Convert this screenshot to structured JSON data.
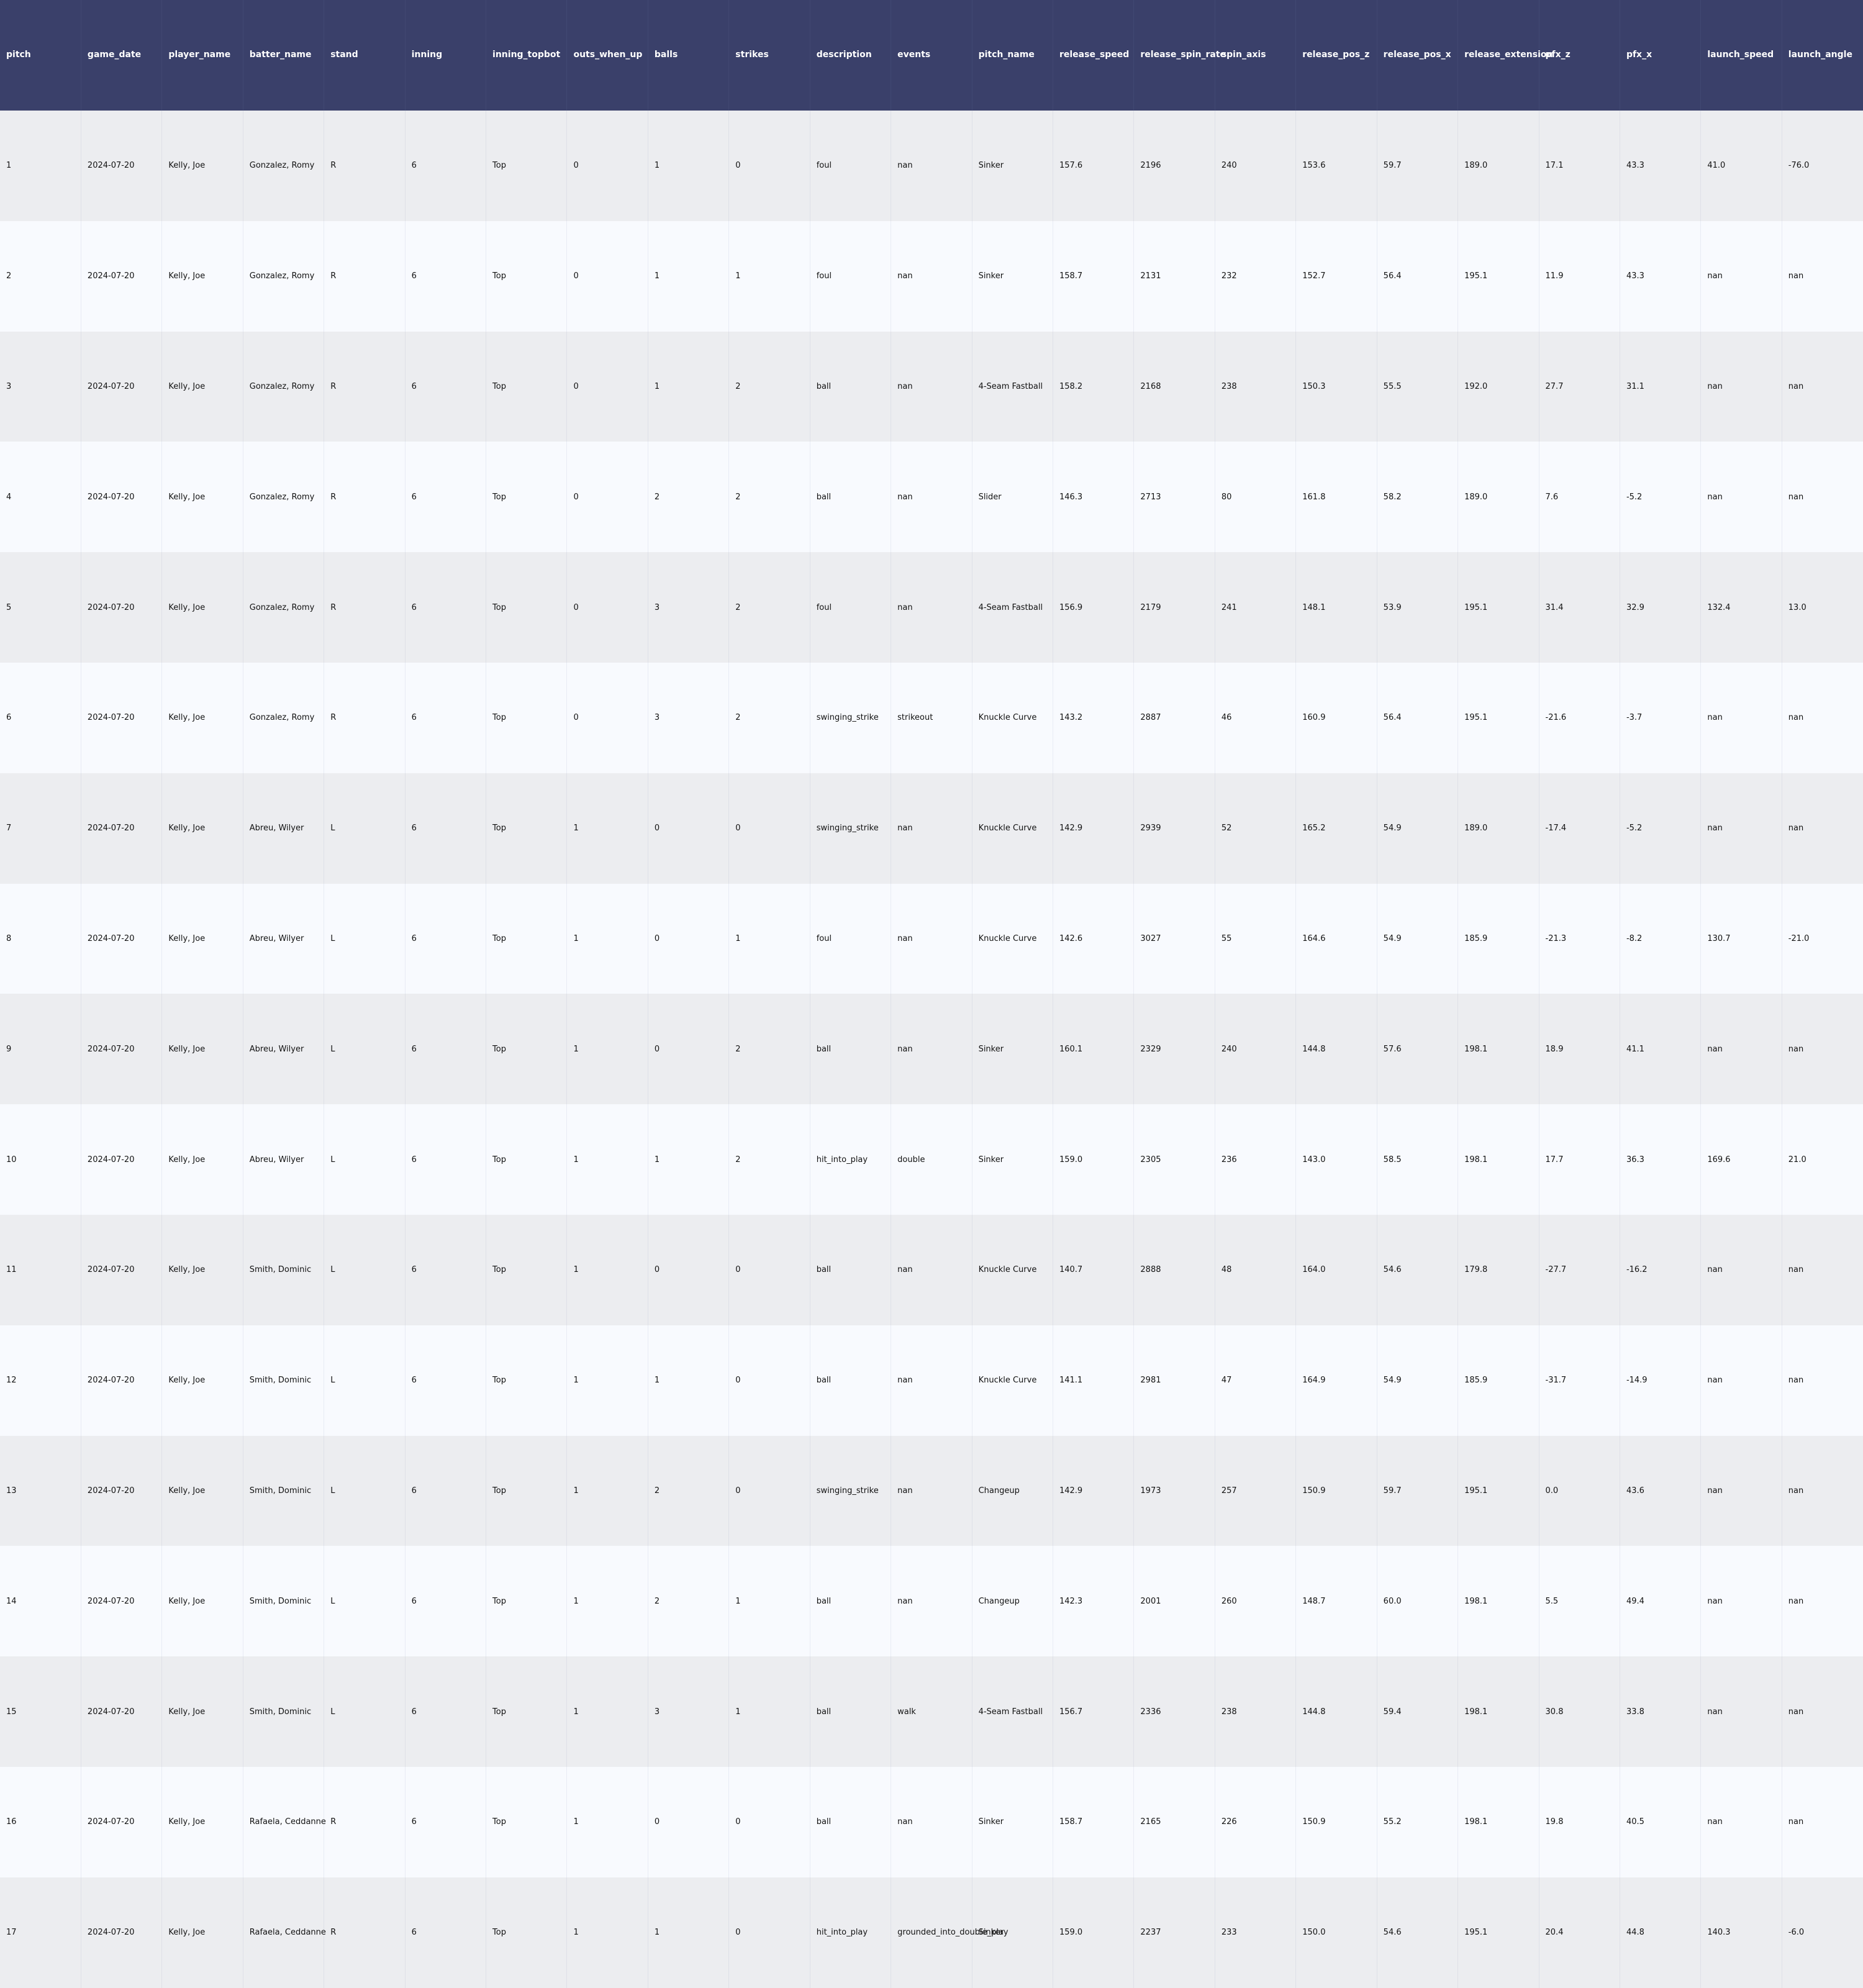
{
  "columns": [
    "pitch",
    "game_date",
    "player_name",
    "batter_name",
    "stand",
    "inning",
    "inning_topbot",
    "outs_when_up",
    "balls",
    "strikes",
    "description",
    "events",
    "pitch_name",
    "release_speed",
    "release_spin_rate",
    "spin_axis",
    "release_pos_z",
    "release_pos_x",
    "release_extension",
    "pfx_z",
    "pfx_x",
    "launch_speed",
    "launch_angle"
  ],
  "rows": [
    [
      "1",
      "2024-07-20",
      "Kelly, Joe",
      "Gonzalez, Romy",
      "R",
      "6",
      "Top",
      "0",
      "1",
      "0",
      "foul",
      "nan",
      "Sinker",
      "157.6",
      "2196",
      "240",
      "153.6",
      "59.7",
      "189.0",
      "17.1",
      "43.3",
      "41.0",
      "-76.0"
    ],
    [
      "2",
      "2024-07-20",
      "Kelly, Joe",
      "Gonzalez, Romy",
      "R",
      "6",
      "Top",
      "0",
      "1",
      "1",
      "foul",
      "nan",
      "Sinker",
      "158.7",
      "2131",
      "232",
      "152.7",
      "56.4",
      "195.1",
      "11.9",
      "43.3",
      "nan",
      "nan"
    ],
    [
      "3",
      "2024-07-20",
      "Kelly, Joe",
      "Gonzalez, Romy",
      "R",
      "6",
      "Top",
      "0",
      "1",
      "2",
      "ball",
      "nan",
      "4-Seam Fastball",
      "158.2",
      "2168",
      "238",
      "150.3",
      "55.5",
      "192.0",
      "27.7",
      "31.1",
      "nan",
      "nan"
    ],
    [
      "4",
      "2024-07-20",
      "Kelly, Joe",
      "Gonzalez, Romy",
      "R",
      "6",
      "Top",
      "0",
      "2",
      "2",
      "ball",
      "nan",
      "Slider",
      "146.3",
      "2713",
      "80",
      "161.8",
      "58.2",
      "189.0",
      "7.6",
      "-5.2",
      "nan",
      "nan"
    ],
    [
      "5",
      "2024-07-20",
      "Kelly, Joe",
      "Gonzalez, Romy",
      "R",
      "6",
      "Top",
      "0",
      "3",
      "2",
      "foul",
      "nan",
      "4-Seam Fastball",
      "156.9",
      "2179",
      "241",
      "148.1",
      "53.9",
      "195.1",
      "31.4",
      "32.9",
      "132.4",
      "13.0"
    ],
    [
      "6",
      "2024-07-20",
      "Kelly, Joe",
      "Gonzalez, Romy",
      "R",
      "6",
      "Top",
      "0",
      "3",
      "2",
      "swinging_strike",
      "strikeout",
      "Knuckle Curve",
      "143.2",
      "2887",
      "46",
      "160.9",
      "56.4",
      "195.1",
      "-21.6",
      "-3.7",
      "nan",
      "nan"
    ],
    [
      "7",
      "2024-07-20",
      "Kelly, Joe",
      "Abreu, Wilyer",
      "L",
      "6",
      "Top",
      "1",
      "0",
      "0",
      "swinging_strike",
      "nan",
      "Knuckle Curve",
      "142.9",
      "2939",
      "52",
      "165.2",
      "54.9",
      "189.0",
      "-17.4",
      "-5.2",
      "nan",
      "nan"
    ],
    [
      "8",
      "2024-07-20",
      "Kelly, Joe",
      "Abreu, Wilyer",
      "L",
      "6",
      "Top",
      "1",
      "0",
      "1",
      "foul",
      "nan",
      "Knuckle Curve",
      "142.6",
      "3027",
      "55",
      "164.6",
      "54.9",
      "185.9",
      "-21.3",
      "-8.2",
      "130.7",
      "-21.0"
    ],
    [
      "9",
      "2024-07-20",
      "Kelly, Joe",
      "Abreu, Wilyer",
      "L",
      "6",
      "Top",
      "1",
      "0",
      "2",
      "ball",
      "nan",
      "Sinker",
      "160.1",
      "2329",
      "240",
      "144.8",
      "57.6",
      "198.1",
      "18.9",
      "41.1",
      "nan",
      "nan"
    ],
    [
      "10",
      "2024-07-20",
      "Kelly, Joe",
      "Abreu, Wilyer",
      "L",
      "6",
      "Top",
      "1",
      "1",
      "2",
      "hit_into_play",
      "double",
      "Sinker",
      "159.0",
      "2305",
      "236",
      "143.0",
      "58.5",
      "198.1",
      "17.7",
      "36.3",
      "169.6",
      "21.0"
    ],
    [
      "11",
      "2024-07-20",
      "Kelly, Joe",
      "Smith, Dominic",
      "L",
      "6",
      "Top",
      "1",
      "0",
      "0",
      "ball",
      "nan",
      "Knuckle Curve",
      "140.7",
      "2888",
      "48",
      "164.0",
      "54.6",
      "179.8",
      "-27.7",
      "-16.2",
      "nan",
      "nan"
    ],
    [
      "12",
      "2024-07-20",
      "Kelly, Joe",
      "Smith, Dominic",
      "L",
      "6",
      "Top",
      "1",
      "1",
      "0",
      "ball",
      "nan",
      "Knuckle Curve",
      "141.1",
      "2981",
      "47",
      "164.9",
      "54.9",
      "185.9",
      "-31.7",
      "-14.9",
      "nan",
      "nan"
    ],
    [
      "13",
      "2024-07-20",
      "Kelly, Joe",
      "Smith, Dominic",
      "L",
      "6",
      "Top",
      "1",
      "2",
      "0",
      "swinging_strike",
      "nan",
      "Changeup",
      "142.9",
      "1973",
      "257",
      "150.9",
      "59.7",
      "195.1",
      "0.0",
      "43.6",
      "nan",
      "nan"
    ],
    [
      "14",
      "2024-07-20",
      "Kelly, Joe",
      "Smith, Dominic",
      "L",
      "6",
      "Top",
      "1",
      "2",
      "1",
      "ball",
      "nan",
      "Changeup",
      "142.3",
      "2001",
      "260",
      "148.7",
      "60.0",
      "198.1",
      "5.5",
      "49.4",
      "nan",
      "nan"
    ],
    [
      "15",
      "2024-07-20",
      "Kelly, Joe",
      "Smith, Dominic",
      "L",
      "6",
      "Top",
      "1",
      "3",
      "1",
      "ball",
      "walk",
      "4-Seam Fastball",
      "156.7",
      "2336",
      "238",
      "144.8",
      "59.4",
      "198.1",
      "30.8",
      "33.8",
      "nan",
      "nan"
    ],
    [
      "16",
      "2024-07-20",
      "Kelly, Joe",
      "Rafaela, Ceddanne",
      "R",
      "6",
      "Top",
      "1",
      "0",
      "0",
      "ball",
      "nan",
      "Sinker",
      "158.7",
      "2165",
      "226",
      "150.9",
      "55.2",
      "198.1",
      "19.8",
      "40.5",
      "nan",
      "nan"
    ],
    [
      "17",
      "2024-07-20",
      "Kelly, Joe",
      "Rafaela, Ceddanne",
      "R",
      "6",
      "Top",
      "1",
      "1",
      "0",
      "hit_into_play",
      "grounded_into_double_play",
      "Sinker",
      "159.0",
      "2237",
      "233",
      "150.0",
      "54.6",
      "195.1",
      "20.4",
      "44.8",
      "140.3",
      "-6.0"
    ]
  ],
  "colors": {
    "header_bg": "#3a406a",
    "header_text": "#ffffff",
    "row_odd": "#ecedf0",
    "row_even": "#f8fafe"
  }
}
